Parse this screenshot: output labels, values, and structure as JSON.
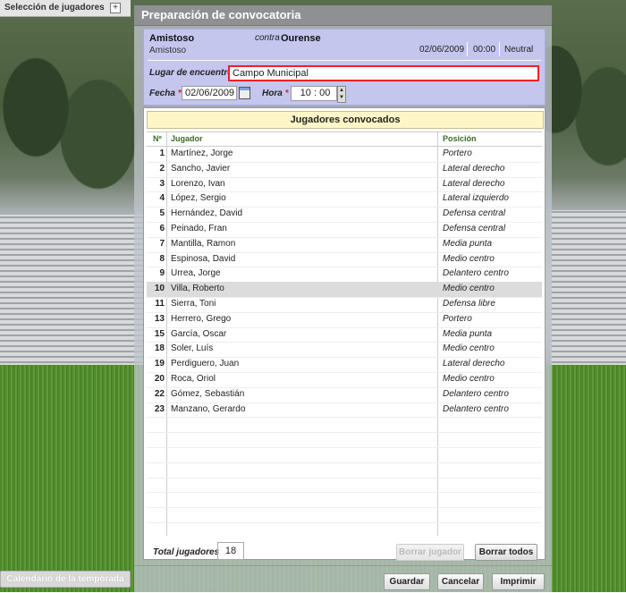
{
  "sidebar": {
    "title": "Selección de jugadores",
    "add_icon": "plus-icon",
    "calendar_button": "Calendario de la temporada"
  },
  "dialog": {
    "title": "Preparación de convocatoria"
  },
  "match": {
    "team": "Amistoso",
    "competition": "Amistoso",
    "contra_label": "contra",
    "rival": "Ourense",
    "date": "02/06/2009",
    "time": "00:00",
    "field": "Neutral"
  },
  "form": {
    "place_label": "Lugar de encuentro",
    "place_value": "Campo Municipal",
    "date_label": "Fecha",
    "date_value": "02/06/2009",
    "time_label": "Hora",
    "time_value": "10 : 00",
    "required_mark": "*"
  },
  "players": {
    "title": "Jugadores convocados",
    "headers": {
      "num": "Nº",
      "player": "Jugador",
      "position": "Posición"
    },
    "rows": [
      {
        "num": "1",
        "name": "Martínez, Jorge",
        "position": "Portero"
      },
      {
        "num": "2",
        "name": "Sancho, Javier",
        "position": "Lateral derecho"
      },
      {
        "num": "3",
        "name": "Lorenzo, Ivan",
        "position": "Lateral derecho"
      },
      {
        "num": "4",
        "name": "López, Sergio",
        "position": "Lateral izquierdo"
      },
      {
        "num": "5",
        "name": "Hernández, David",
        "position": "Defensa central"
      },
      {
        "num": "6",
        "name": "Peinado, Fran",
        "position": "Defensa central"
      },
      {
        "num": "7",
        "name": "Mantilla, Ramon",
        "position": "Media punta"
      },
      {
        "num": "8",
        "name": "Espinosa, David",
        "position": "Medio centro"
      },
      {
        "num": "9",
        "name": "Urrea, Jorge",
        "position": "Delantero centro"
      },
      {
        "num": "10",
        "name": "Villa, Roberto",
        "position": "Medio centro"
      },
      {
        "num": "11",
        "name": "Sierra, Toni",
        "position": "Defensa libre"
      },
      {
        "num": "13",
        "name": "Herrero, Grego",
        "position": "Portero"
      },
      {
        "num": "15",
        "name": "García, Oscar",
        "position": "Media punta"
      },
      {
        "num": "18",
        "name": "Soler, Luís",
        "position": "Medio centro"
      },
      {
        "num": "19",
        "name": "Perdiguero, Juan",
        "position": "Lateral derecho"
      },
      {
        "num": "20",
        "name": "Roca, Oriol",
        "position": "Medio centro"
      },
      {
        "num": "22",
        "name": "Gómez, Sebastián",
        "position": "Delantero centro"
      },
      {
        "num": "23",
        "name": "Manzano, Gerardo",
        "position": "Delantero centro"
      }
    ],
    "selected_index": 9,
    "total_label": "Total jugadores",
    "total_value": "18",
    "delete_button": "Borrar jugador",
    "delete_all_button": "Borrar todos"
  },
  "footer": {
    "save": "Guardar",
    "cancel": "Cancelar",
    "print": "Imprimir"
  }
}
